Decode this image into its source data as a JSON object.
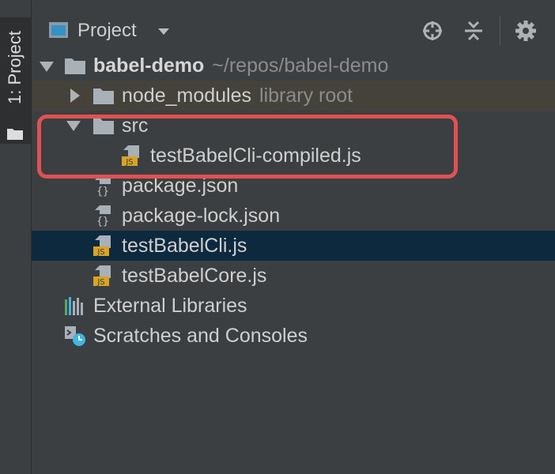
{
  "tool_window": {
    "side_tab_label": "1: Project",
    "icon": "folder-icon"
  },
  "header": {
    "title": "Project",
    "view_icon": "project-view-icon",
    "actions": [
      {
        "name": "locate-icon"
      },
      {
        "name": "collapse-all-icon"
      },
      {
        "name": "gear-icon"
      }
    ]
  },
  "tree": {
    "root": {
      "label": "babel-demo",
      "hint": "~/repos/babel-demo",
      "expanded": true
    },
    "items": [
      {
        "label": "node_modules",
        "hint": "library root",
        "type": "folder",
        "expanded": false
      },
      {
        "label": "src",
        "type": "folder",
        "expanded": true
      },
      {
        "label": "testBabelCli-compiled.js",
        "type": "js-file"
      },
      {
        "label": "package.json",
        "type": "json-file"
      },
      {
        "label": "package-lock.json",
        "type": "json-file"
      },
      {
        "label": "testBabelCli.js",
        "type": "js-file",
        "selected": true
      },
      {
        "label": "testBabelCore.js",
        "type": "js-file"
      },
      {
        "label": "External Libraries",
        "type": "libraries"
      },
      {
        "label": "Scratches and Consoles",
        "type": "scratches"
      }
    ]
  },
  "colors": {
    "background": "#3c3f41",
    "selection": "#0d293e",
    "library_root_row": "#45423b",
    "highlight_box": "#e05252",
    "js_badge": "#d9a323"
  }
}
